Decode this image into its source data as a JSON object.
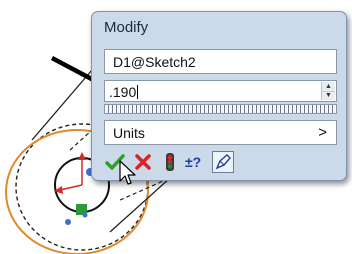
{
  "dialog": {
    "title": "Modify",
    "dimension_name": "D1@Sketch2",
    "value": ".190",
    "units_label": "Units",
    "units_arrow": ">"
  },
  "toolbar": {
    "buttons": [
      {
        "icon": "checkmark-icon",
        "color": "#2aa02a"
      },
      {
        "icon": "cancel-x-icon",
        "color": "#e02020"
      },
      {
        "icon": "rebuild-traffic-light-icon",
        "color": "#cc1a1a"
      },
      {
        "icon": "reverse-sense-icon",
        "symbol": "±?",
        "color": "#1a3fa8"
      },
      {
        "icon": "mark-for-drawing-icon",
        "color": "#1a3fa8"
      }
    ]
  },
  "colors": {
    "dialog_bg": "#ccd9e8",
    "sketch_circle": "#e28a2a",
    "sketch_line": "#000000"
  }
}
